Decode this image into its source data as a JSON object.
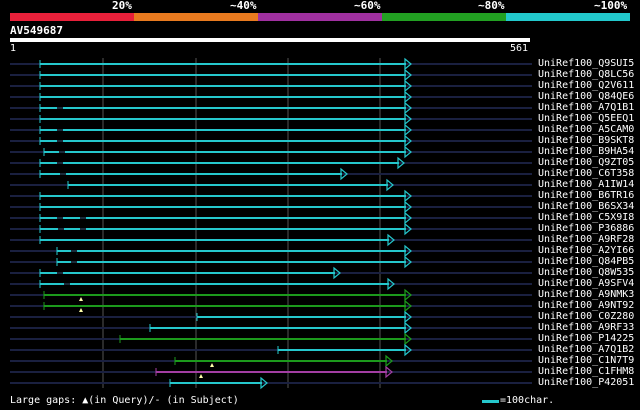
{
  "header": {
    "percent_marks": [
      "20%",
      "~40%",
      "~60%",
      "~80%",
      "~100%"
    ],
    "color_scale": [
      "#e8203a",
      "#e87a1f",
      "#a030a0",
      "#22a022",
      "#22c8cc"
    ]
  },
  "query": {
    "id": "AV549687",
    "ruler_start": "1",
    "ruler_end": "561"
  },
  "colors": {
    "cyan": "#25c7cc",
    "green": "#1c9a1c",
    "purple": "#a33ea3",
    "dark_line": "#1a2040",
    "grid": "#555555"
  },
  "hits": [
    {
      "label": "UniRef100_Q9SUI5",
      "start": 40,
      "end": 411,
      "color": "cyan",
      "dotted": []
    },
    {
      "label": "UniRef100_Q8LC56",
      "start": 40,
      "end": 411,
      "color": "cyan",
      "dotted": []
    },
    {
      "label": "UniRef100_Q2V611",
      "start": 40,
      "end": 411,
      "color": "cyan",
      "dotted": []
    },
    {
      "label": "UniRef100_Q84QE6",
      "start": 40,
      "end": 411,
      "color": "cyan",
      "dotted": []
    },
    {
      "label": "UniRef100_A7Q1B1",
      "start": 40,
      "end": 411,
      "color": "cyan",
      "dotted": [
        57
      ]
    },
    {
      "label": "UniRef100_Q5EEQ1",
      "start": 40,
      "end": 411,
      "color": "cyan",
      "dotted": []
    },
    {
      "label": "UniRef100_A5CAM0",
      "start": 40,
      "end": 411,
      "color": "cyan",
      "dotted": [
        57
      ]
    },
    {
      "label": "UniRef100_B9SKT8",
      "start": 40,
      "end": 411,
      "color": "cyan",
      "dotted": [
        57
      ]
    },
    {
      "label": "UniRef100_B9HA54",
      "start": 44,
      "end": 411,
      "color": "cyan",
      "dotted": [
        59
      ]
    },
    {
      "label": "UniRef100_Q9ZT05",
      "start": 40,
      "end": 404,
      "color": "cyan",
      "dotted": [
        57
      ]
    },
    {
      "label": "UniRef100_C6T358",
      "start": 40,
      "end": 347,
      "color": "cyan",
      "dotted": [
        60
      ]
    },
    {
      "label": "UniRef100_A1IW14",
      "start": 68,
      "end": 393,
      "color": "cyan",
      "dotted": []
    },
    {
      "label": "UniRef100_B6TR16",
      "start": 40,
      "end": 411,
      "color": "cyan",
      "dotted": []
    },
    {
      "label": "UniRef100_B6SX34",
      "start": 40,
      "end": 411,
      "color": "cyan",
      "dotted": []
    },
    {
      "label": "UniRef100_C5X9I8",
      "start": 40,
      "end": 411,
      "color": "cyan",
      "dotted": [
        57,
        80
      ]
    },
    {
      "label": "UniRef100_P36886",
      "start": 40,
      "end": 411,
      "color": "cyan",
      "dotted": [
        58,
        80
      ]
    },
    {
      "label": "UniRef100_A9RF28",
      "start": 40,
      "end": 394,
      "color": "cyan",
      "dotted": []
    },
    {
      "label": "UniRef100_A2YI66",
      "start": 57,
      "end": 411,
      "color": "cyan",
      "dotted": [
        71
      ]
    },
    {
      "label": "UniRef100_Q84PB5",
      "start": 57,
      "end": 411,
      "color": "cyan",
      "dotted": [
        71
      ]
    },
    {
      "label": "UniRef100_Q8W535",
      "start": 40,
      "end": 340,
      "color": "cyan",
      "dotted": [
        57
      ]
    },
    {
      "label": "UniRef100_A9SFV4",
      "start": 40,
      "end": 394,
      "color": "cyan",
      "dotted": [
        64
      ]
    },
    {
      "label": "UniRef100_A9NMK3",
      "start": 44,
      "end": 411,
      "color": "green",
      "dotted": [],
      "gaps": [
        81
      ]
    },
    {
      "label": "UniRef100_A9NT92",
      "start": 44,
      "end": 411,
      "color": "green",
      "dotted": [],
      "gaps": [
        81
      ]
    },
    {
      "label": "UniRef100_C0Z280",
      "start": 197,
      "end": 411,
      "color": "cyan",
      "dotted": []
    },
    {
      "label": "UniRef100_A9RF33",
      "start": 150,
      "end": 411,
      "color": "cyan",
      "dotted": []
    },
    {
      "label": "UniRef100_P14225",
      "start": 120,
      "end": 411,
      "color": "green",
      "dotted": []
    },
    {
      "label": "UniRef100_A7Q1B2",
      "start": 278,
      "end": 411,
      "color": "cyan",
      "dotted": []
    },
    {
      "label": "UniRef100_C1N7T9",
      "start": 175,
      "end": 392,
      "color": "green",
      "dotted": [],
      "gaps": [
        212
      ]
    },
    {
      "label": "UniRef100_C1FHM8",
      "start": 156,
      "end": 392,
      "color": "purple",
      "dotted": [],
      "gaps": [
        201
      ]
    },
    {
      "label": "UniRef100_P42051",
      "start": 170,
      "end": 267,
      "color": "cyan",
      "dotted": []
    }
  ],
  "legend": {
    "gaps_text": "Large gaps: ▲(in Query)/- (in Subject)",
    "scale_text": "=100char."
  }
}
